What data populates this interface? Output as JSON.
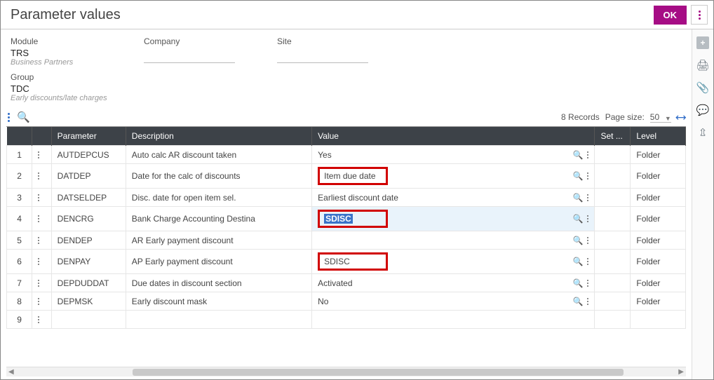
{
  "title": "Parameter values",
  "ok_label": "OK",
  "header": {
    "module_label": "Module",
    "module_value": "TRS",
    "module_hint": "Business Partners",
    "company_label": "Company",
    "site_label": "Site",
    "group_label": "Group",
    "group_value": "TDC",
    "group_hint": "Early discounts/late charges"
  },
  "toolbar": {
    "records_text": "8 Records",
    "pagesize_label": "Page size:",
    "pagesize_value": "50"
  },
  "columns": {
    "parameter": "Parameter",
    "description": "Description",
    "value": "Value",
    "set": "Set ...",
    "level": "Level"
  },
  "rows": [
    {
      "n": "1",
      "param": "AUTDEPCUS",
      "desc": "Auto calc AR discount taken",
      "value": "Yes",
      "level": "Folder",
      "hl": false,
      "editing": false
    },
    {
      "n": "2",
      "param": "DATDEP",
      "desc": "Date for the calc of discounts",
      "value": "Item due date",
      "level": "Folder",
      "hl": true,
      "editing": false
    },
    {
      "n": "3",
      "param": "DATSELDEP",
      "desc": "Disc. date for open item sel.",
      "value": "Earliest discount date",
      "level": "Folder",
      "hl": false,
      "editing": false
    },
    {
      "n": "4",
      "param": "DENCRG",
      "desc": "Bank Charge Accounting Destina",
      "value": "SDISC",
      "level": "Folder",
      "hl": true,
      "editing": true
    },
    {
      "n": "5",
      "param": "DENDEP",
      "desc": "AR Early payment discount",
      "value": "",
      "level": "Folder",
      "hl": false,
      "editing": false
    },
    {
      "n": "6",
      "param": "DENPAY",
      "desc": "AP Early payment discount",
      "value": "SDISC",
      "level": "Folder",
      "hl": true,
      "editing": false
    },
    {
      "n": "7",
      "param": "DEPDUDDAT",
      "desc": "Due dates in discount section",
      "value": "Activated",
      "level": "Folder",
      "hl": false,
      "editing": false
    },
    {
      "n": "8",
      "param": "DEPMSK",
      "desc": "Early discount mask",
      "value": "No",
      "level": "Folder",
      "hl": false,
      "editing": false
    },
    {
      "n": "9",
      "param": "",
      "desc": "",
      "value": "",
      "level": "",
      "hl": false,
      "editing": false
    }
  ]
}
